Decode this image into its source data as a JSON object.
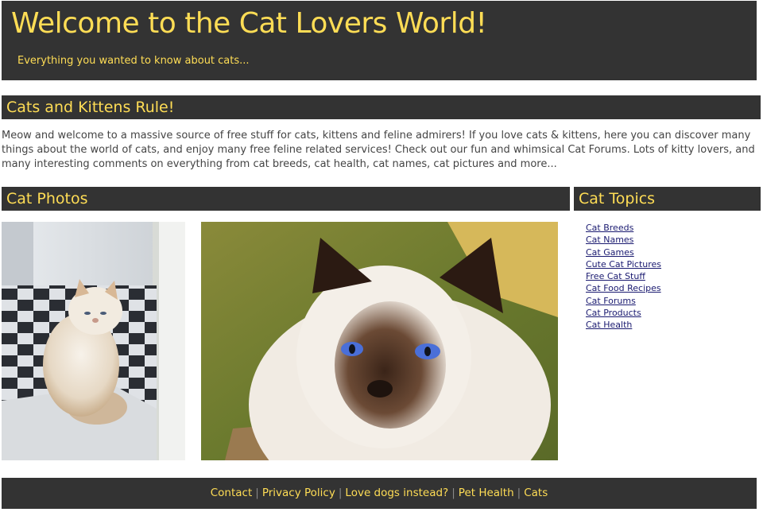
{
  "header": {
    "title": "Welcome to the Cat Lovers World!",
    "tagline": "Everything you wanted to know about cats..."
  },
  "intro": {
    "heading": "Cats and Kittens Rule!",
    "text": "Meow and welcome to a massive source of free stuff for cats, kittens and feline admirers! If you love cats & kittens, here you can discover many things about the world of cats, and enjoy many free feline related services! Check out our fun and whimsical Cat Forums. Lots of kitty lovers, and many interesting comments on everything from cat breeds, cat health, cat names, cat pictures and more..."
  },
  "photos": {
    "heading": "Cat Photos"
  },
  "topics": {
    "heading": "Cat Topics",
    "links": [
      "Cat Breeds",
      "Cat Names",
      "Cat Games",
      "Cute Cat Pictures",
      "Free Cat Stuff",
      "Cat Food Recipes",
      "Cat Forums",
      "Cat Products",
      "Cat Health"
    ]
  },
  "footer": {
    "links": [
      "Contact",
      "Privacy Policy",
      "Love dogs instead?",
      "Pet Health",
      "Cats"
    ]
  },
  "colors": {
    "bar_bg": "#333333",
    "accent": "#FFDD55"
  }
}
